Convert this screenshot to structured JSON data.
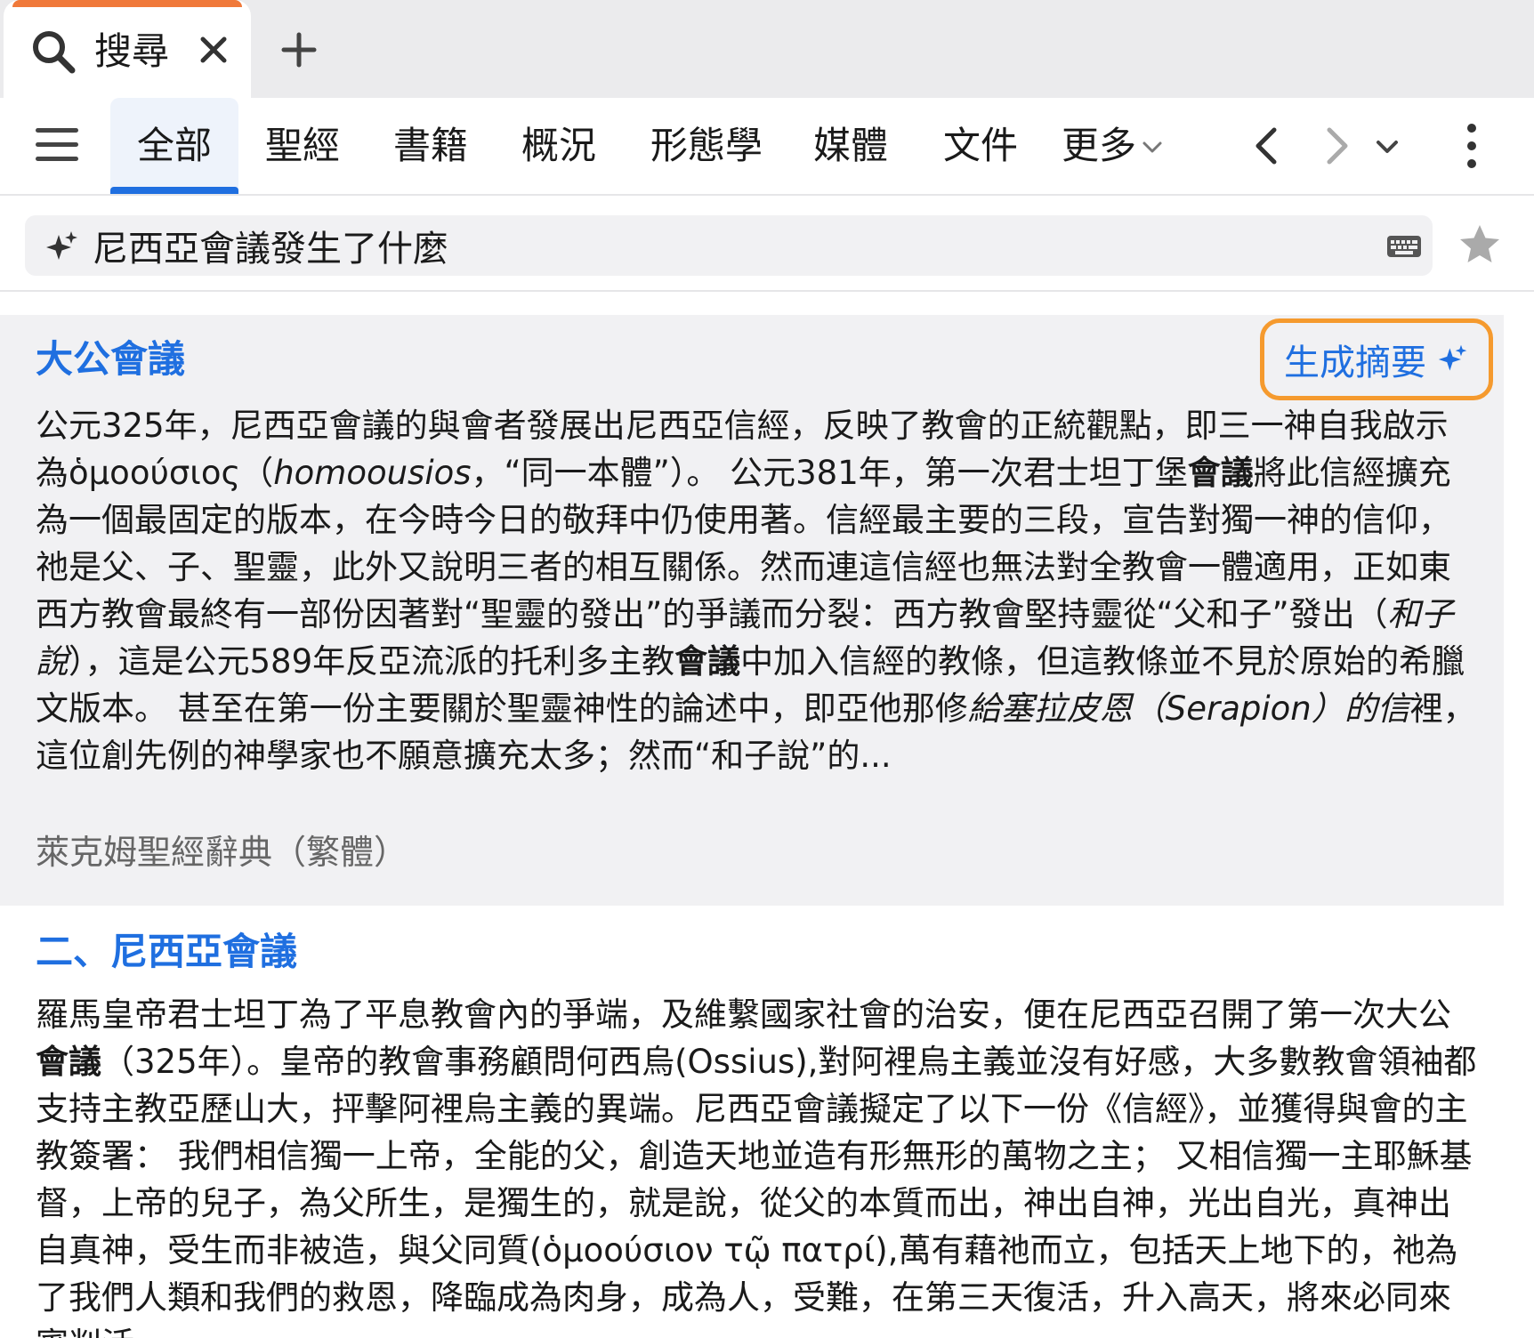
{
  "tabstrip": {
    "active_tab_label": "搜尋"
  },
  "nav": {
    "tabs": [
      "全部",
      "聖經",
      "書籍",
      "概況",
      "形態學",
      "媒體",
      "文件",
      "更多"
    ]
  },
  "search": {
    "query": "尼西亞會議發生了什麼"
  },
  "results": [
    {
      "title": "大公會議",
      "summary_button": "生成摘要",
      "body": [
        {
          "t": "公元325年，尼西亞會議的與會者發展出尼西亞信經，反映了教會的正統觀點，即三一神自我啟示為ὁμοούσιος（"
        },
        {
          "t": "homoousios",
          "i": true
        },
        {
          "t": "，“同一本體”）。 公元381年，第一次君士坦丁堡"
        },
        {
          "t": "會議",
          "b": true
        },
        {
          "t": "將此信經擴充為一個最固定的版本，在今時今日的敬拜中仍使用著。信經最主要的三段，宣告對獨一神的信仰，祂是父、子、聖靈，此外又說明三者的相互關係。然而連這信經也無法對全教會一體適用，正如東西方教會最終有一部份因著對“聖靈的發出”的爭議而分裂：西方教會堅持靈從“父和子”發出（"
        },
        {
          "t": "和子說",
          "i": true
        },
        {
          "t": "），這是公元589年反亞流派的托利多主教"
        },
        {
          "t": "會議",
          "b": true
        },
        {
          "t": "中加入信經的教條，但這教條並不見於原始的希臘文版本。 甚至在第一份主要關於聖靈神性的論述中，即亞他那修"
        },
        {
          "t": "給塞拉皮恩（Serapion）的信",
          "i": true
        },
        {
          "t": "裡，這位創先例的神學家也不願意擴充太多；然而“和子說”的..."
        }
      ],
      "source": "萊克姆聖經辭典（繁體）"
    },
    {
      "title": "二、尼西亞會議",
      "body": [
        {
          "t": "羅馬皇帝君士坦丁為了平息教會內的爭端，及維繫國家社會的治安，便在尼西亞召開了第一次大公"
        },
        {
          "t": "會議",
          "b": true
        },
        {
          "t": "（325年）。皇帝的教會事務顧問何西烏(Ossius),對阿裡烏主義並沒有好感，大多數教會領袖都支持主教亞歷山大，抨擊阿裡烏主義的異端。尼西亞會議擬定了以下一份《信經》，並獲得與會的主教簽署： 我們相信獨一上帝，全能的父，創造天地並造有形無形的萬物之主； 又相信獨一主耶穌基督，上帝的兒子，為父所生，是獨生的，就是說，從父的本質而出，神出自神，光出自光，真神出自真神，受生而非被造，與父同質(ὁμοούσιον τῷ πατρί),萬有藉祂而立，包括天上地下的，祂為了我們人類和我們的救恩，降臨成為肉身，成為人，受難，在第三天復活，升入高天，將來必同來審判活"
        }
      ]
    }
  ],
  "colors": {
    "accent_orange": "#f0793a",
    "link_blue": "#1f6fe0",
    "highlight_border": "#f59a2e"
  }
}
